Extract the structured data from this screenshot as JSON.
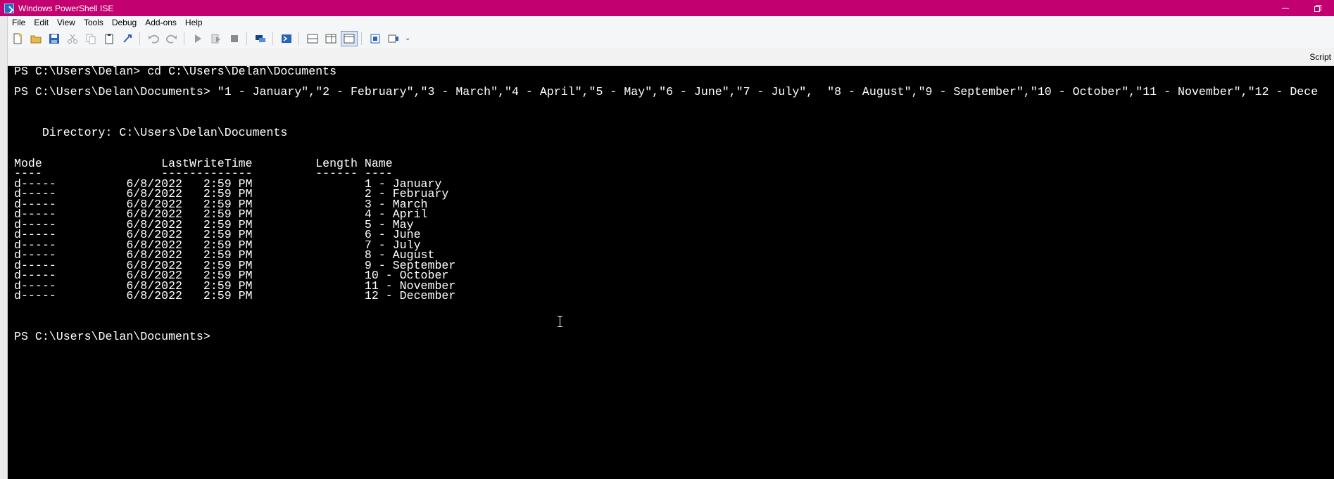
{
  "window": {
    "title": "Windows PowerShell ISE"
  },
  "menu": {
    "items": [
      "File",
      "Edit",
      "View",
      "Tools",
      "Debug",
      "Add-ons",
      "Help"
    ]
  },
  "toolbar": {
    "icons": [
      "new-script-icon",
      "open-icon",
      "save-icon",
      "cut-icon",
      "copy-icon",
      "paste-icon",
      "clear-console-icon",
      "undo-icon",
      "redo-icon",
      "run-script-icon",
      "run-selection-icon",
      "stop-icon",
      "new-remote-tab-icon",
      "powershell-console-icon",
      "show-script-top-icon",
      "show-script-right-icon",
      "show-script-max-icon",
      "show-script-pane-icon",
      "show-command-pane-icon"
    ],
    "overflow": "⌄"
  },
  "panel": {
    "script_label": "Script"
  },
  "console": {
    "lines": [
      "PS C:\\Users\\Delan> cd C:\\Users\\Delan\\Documents",
      "",
      "PS C:\\Users\\Delan\\Documents> \"1 - January\",\"2 - February\",\"3 - March\",\"4 - April\",\"5 - May\",\"6 - June\",\"7 - July\",  \"8 - August\",\"9 - September\",\"10 - October\",\"11 - November\",\"12 - Dece",
      "",
      "",
      "",
      "    Directory: C:\\Users\\Delan\\Documents",
      "",
      "",
      "Mode                 LastWriteTime         Length Name",
      "----                 -------------         ------ ----",
      "d-----          6/8/2022   2:59 PM                1 - January",
      "d-----          6/8/2022   2:59 PM                2 - February",
      "d-----          6/8/2022   2:59 PM                3 - March",
      "d-----          6/8/2022   2:59 PM                4 - April",
      "d-----          6/8/2022   2:59 PM                5 - May",
      "d-----          6/8/2022   2:59 PM                6 - June",
      "d-----          6/8/2022   2:59 PM                7 - July",
      "d-----          6/8/2022   2:59 PM                8 - August",
      "d-----          6/8/2022   2:59 PM                9 - September",
      "d-----          6/8/2022   2:59 PM                10 - October",
      "d-----          6/8/2022   2:59 PM                11 - November",
      "d-----          6/8/2022   2:59 PM                12 - December",
      "",
      "",
      "",
      "PS C:\\Users\\Delan\\Documents> "
    ]
  }
}
